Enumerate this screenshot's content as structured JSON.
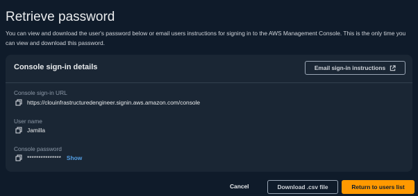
{
  "page": {
    "title": "Retrieve password",
    "description": "You can view and download the user's password below or email users instructions for signing in to the AWS Management Console. This is the only time you can view and download this password."
  },
  "panel": {
    "title": "Console sign-in details",
    "email_button_label": "Email sign-in instructions",
    "email_button_icon": "external-link-icon"
  },
  "fields": {
    "url": {
      "label": "Console sign-in URL",
      "value": "https://clouinfrastructuredengineer.signin.aws.amazon.com/console",
      "icon": "copy-icon"
    },
    "username": {
      "label": "User name",
      "value": "Jamilla",
      "icon": "copy-icon"
    },
    "password": {
      "label": "Console password",
      "value": "***************",
      "show_label": "Show",
      "icon": "copy-icon"
    }
  },
  "footer": {
    "cancel_label": "Cancel",
    "download_label": "Download .csv file",
    "return_label": "Return to users list"
  },
  "colors": {
    "background": "#0f1b2a",
    "panel": "#1a2634",
    "primary": "#ff9900",
    "link": "#539fe5"
  }
}
